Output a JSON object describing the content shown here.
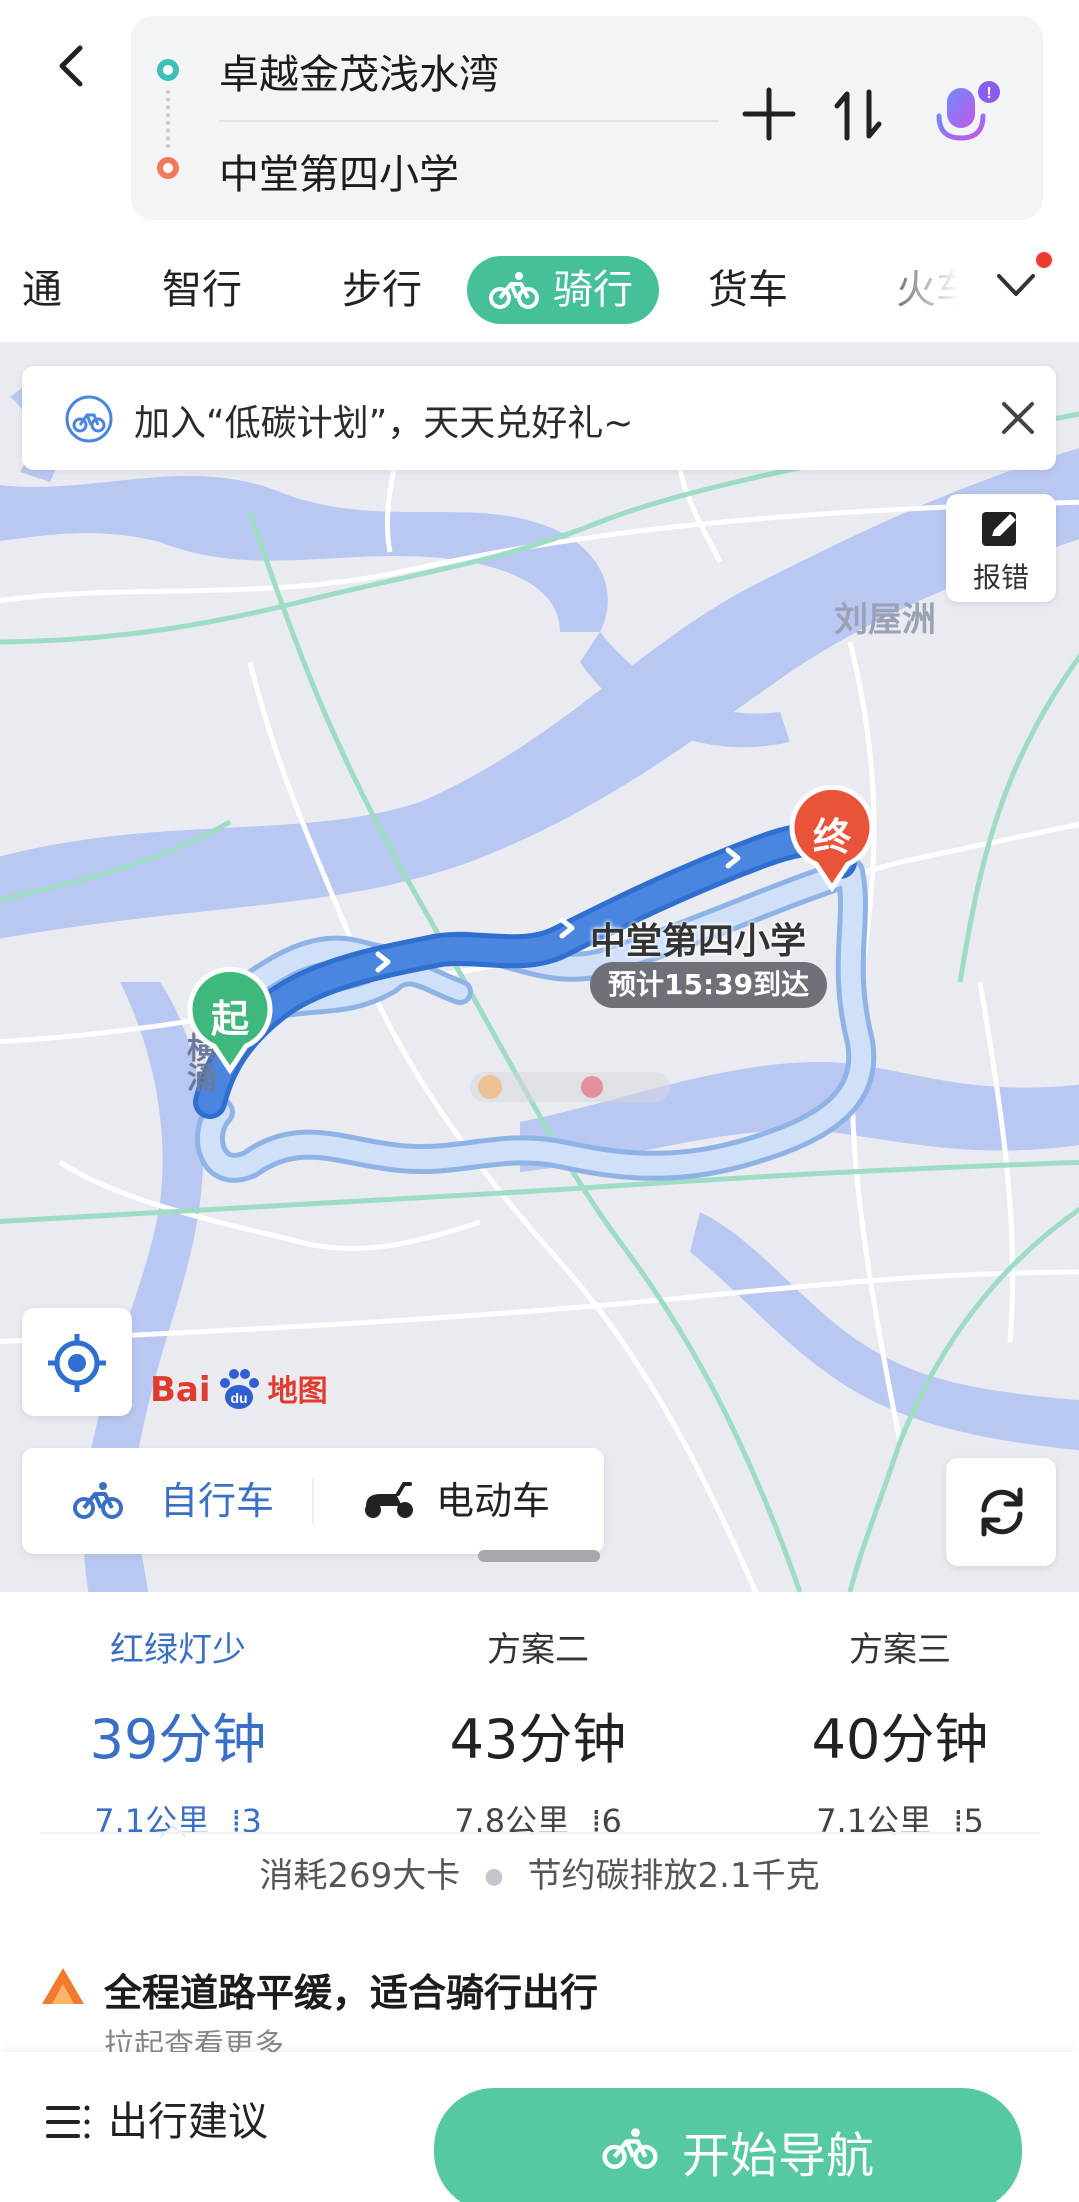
{
  "route": {
    "origin": "卓越金茂浅水湾",
    "destination": "中堂第四小学"
  },
  "tabs": [
    {
      "label": "通",
      "active": false
    },
    {
      "label": "智行",
      "active": false
    },
    {
      "label": "步行",
      "active": false
    },
    {
      "label": "骑行",
      "active": true
    },
    {
      "label": "货车",
      "active": false
    },
    {
      "label": "火车",
      "active": false
    }
  ],
  "banner": {
    "text": "加入“低碳计划”，天天兑好礼~"
  },
  "map": {
    "report_label": "报错",
    "place_liuwuzhou": "刘屋洲",
    "place_hengyong": "横涌",
    "start_pin": "起",
    "end_pin": "终",
    "destination_label": "中堂第四小学",
    "eta": "预计15:39到达",
    "logo_part1": "Bai",
    "logo_part2": "du",
    "logo_part3": "地图"
  },
  "vehicles": {
    "bike": "自行车",
    "ebike": "电动车"
  },
  "plans": [
    {
      "title": "红绿灯少",
      "time": "39分钟",
      "distance": "7.1公里",
      "lights": "3",
      "selected": true
    },
    {
      "title": "方案二",
      "time": "43分钟",
      "distance": "7.8公里",
      "lights": "6",
      "selected": false
    },
    {
      "title": "方案三",
      "time": "40分钟",
      "distance": "7.1公里",
      "lights": "5",
      "selected": false
    }
  ],
  "stats": {
    "calories": "消耗269大卡",
    "carbon": "节约碳排放2.1千克"
  },
  "tip": {
    "title": "全程道路平缓，适合骑行出行",
    "subtitle": "拉起查看更多"
  },
  "actions": {
    "advice": "出行建议",
    "start_nav": "开始导航"
  },
  "colors": {
    "accent_green": "#45c09b",
    "selected_blue": "#3a6fc8",
    "route_blue": "#4a86e0",
    "end_red": "#e8533a"
  }
}
